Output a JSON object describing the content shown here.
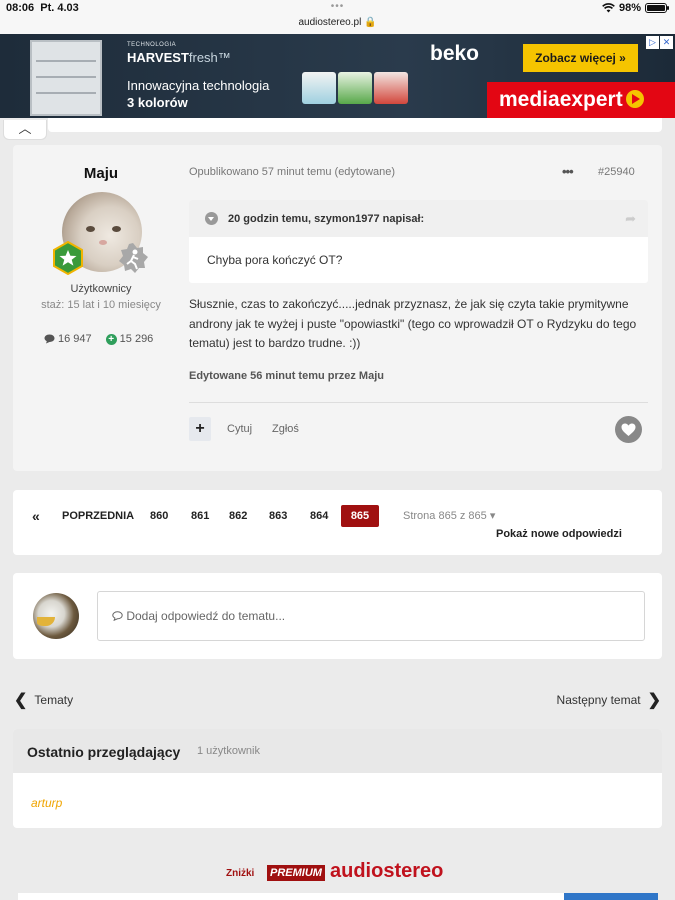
{
  "status_bar": {
    "time": "08:06",
    "date": "Pt. 4.03",
    "dots": "•••",
    "url": "audiostereo.pl 🔒",
    "battery": "98%",
    "battery_level": 0.98
  },
  "ad": {
    "tech_label": "TECHNOLOGIA",
    "harvest": "HARVEST",
    "harvest_suffix": "fresh™",
    "line1": "Innowacyjna technologia",
    "line2": "3 kolorów",
    "brand": "beko",
    "cta": "Zobacz więcej »",
    "retailer": "mediaexpert",
    "ad_mark": "▷",
    "close_mark": "✕"
  },
  "top_collapse": "︿",
  "post": {
    "author": "Maju",
    "role": "Użytkownicy",
    "tenure": "staż: 15 lat i 10 miesięcy",
    "posts_count": "16 947",
    "reputation": "15 296",
    "meta": "Opublikowano 57 minut temu (edytowane)",
    "more": "•••",
    "number": "#25940",
    "quote_title": "20 godzin temu, szymon1977 napisał:",
    "quote_text": "Chyba pora kończyć OT?",
    "content": "Słusznie, czas to zakończyć.....jednak przyznasz, że jak się czyta takie prymitywne androny jak te wyżej i puste \"opowiastki\" (tego co wprowadził OT o Rydzyku do tego tematu) jest to bardzo trudne.   :))",
    "edited": "Edytowane 56 minut temu przez Maju",
    "add_label": "+",
    "cite_label": "Cytuj",
    "report_label": "Zgłoś"
  },
  "pagination": {
    "first": "«",
    "prev": "POPRZEDNIA",
    "pages": [
      "860",
      "861",
      "862",
      "863",
      "864"
    ],
    "current": "865",
    "info": "Strona 865 z 865 ▾",
    "new_replies": "Pokaż nowe odpowiedzi"
  },
  "reply": {
    "placeholder": "Dodaj odpowiedź do tematu..."
  },
  "nav": {
    "back": "Tematy",
    "next": "Następny temat"
  },
  "recent": {
    "title": "Ostatnio przeglądający",
    "count": "1 użytkownik",
    "users": [
      "arturp"
    ]
  },
  "footer": {
    "discounts": "Zniżki",
    "premium": "PREMIUM",
    "brand": "audiostereo"
  },
  "colors": {
    "accent_red": "#a01010",
    "brand_red": "#c0121d",
    "rep_green": "#2e9e5b",
    "viewer_orange": "#f0a500"
  }
}
